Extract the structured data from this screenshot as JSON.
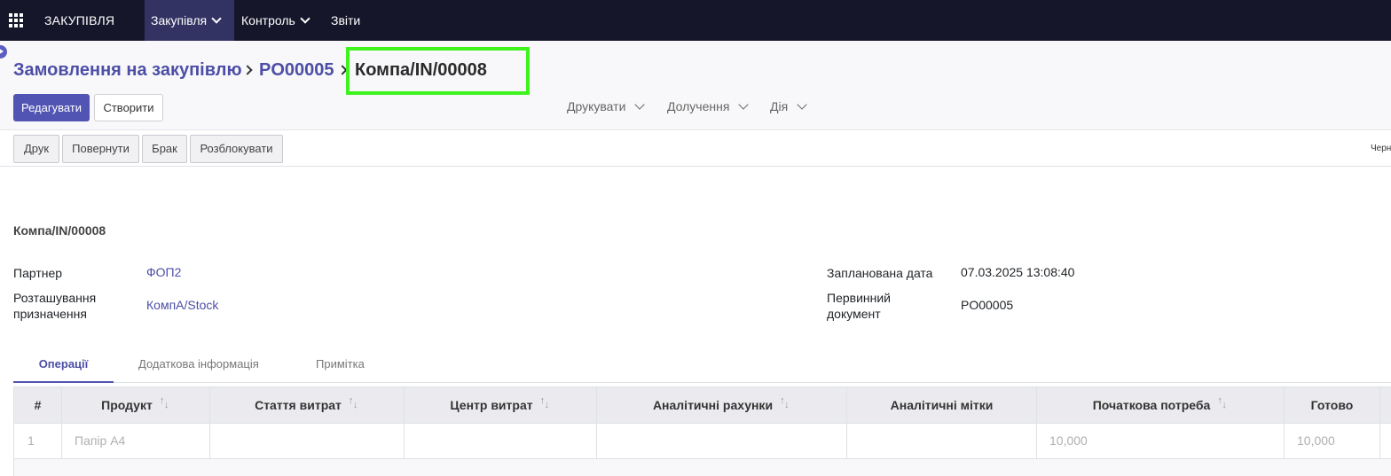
{
  "navbar": {
    "brand": "ЗАКУПІВЛЯ",
    "menu": [
      "Закупівля",
      "Контроль",
      "Звіти"
    ],
    "active_menu": "Закупівля"
  },
  "breadcrumb": {
    "parent": "Замовлення на закупівлю",
    "order": "PO00005",
    "current": "Компа/IN/00008"
  },
  "control_panel": {
    "edit_label": "Редагувати",
    "create_label": "Створити",
    "print_dropdown": "Друкувати",
    "attachment_dropdown": "Долучення",
    "action_dropdown": "Дія"
  },
  "status_buttons": [
    "Друк",
    "Повернути",
    "Брак",
    "Розблокувати"
  ],
  "status_text": "Черн",
  "record": {
    "name": "Компа/IN/00008",
    "partner_label": "Партнер",
    "partner_value": "ФОП2",
    "destination_label_line1": "Розташування",
    "destination_label_line2": "призначення",
    "destination_value": "КомпА/Stock",
    "scheduled_label": "Запланована дата",
    "scheduled_value": "07.03.2025 13:08:40",
    "source_label_line1": "Первинний",
    "source_label_line2": "документ",
    "source_value": "PO00005"
  },
  "tabs": [
    "Операції",
    "Додаткова інформація",
    "Примітка"
  ],
  "active_tab": "Операції",
  "table": {
    "columns": [
      "#",
      "Продукт",
      "Стаття витрат",
      "Центр витрат",
      "Аналітичні рахунки",
      "Аналітичні мітки",
      "Початкова потреба",
      "Готово"
    ],
    "rows": [
      {
        "num": "1",
        "product": "Папір А4",
        "cost_item": "",
        "cost_center": "",
        "analytic_accounts": "",
        "analytic_tags": "",
        "initial_demand": "10,000",
        "done": "10,000"
      }
    ]
  },
  "colors": {
    "navbar_bg": "#16162b",
    "accent": "#5154b3",
    "link": "#4c4ea6",
    "highlight_box": "#3ef31e"
  }
}
